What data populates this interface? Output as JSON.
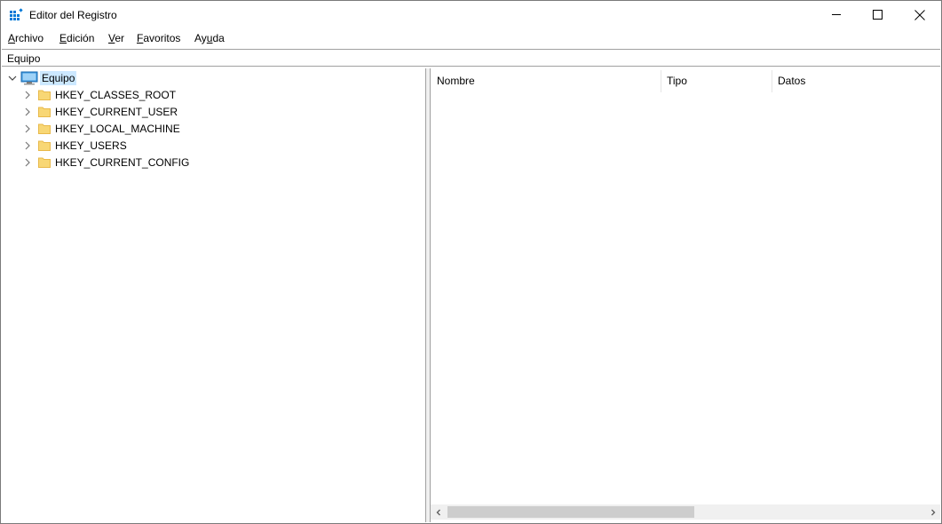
{
  "window": {
    "title": "Editor del Registro"
  },
  "menu": [
    {
      "label": "Archivo",
      "mnemonic": "A",
      "rest": "rchivo"
    },
    {
      "label": "Edición",
      "mnemonic": "E",
      "rest": "dición"
    },
    {
      "label": "Ver",
      "mnemonic": "V",
      "rest": "er"
    },
    {
      "label": "Favoritos",
      "mnemonic": "F",
      "rest": "avoritos"
    },
    {
      "label": "Ayuda",
      "pre": "Ay",
      "mnemonic": "u",
      "rest": "da"
    }
  ],
  "address": {
    "path": "Equipo"
  },
  "tree": {
    "root": {
      "label": "Equipo",
      "icon": "computer-icon",
      "expanded": true
    },
    "children": [
      {
        "label": "HKEY_CLASSES_ROOT",
        "icon": "folder-icon"
      },
      {
        "label": "HKEY_CURRENT_USER",
        "icon": "folder-icon"
      },
      {
        "label": "HKEY_LOCAL_MACHINE",
        "icon": "folder-icon"
      },
      {
        "label": "HKEY_USERS",
        "icon": "folder-icon"
      },
      {
        "label": "HKEY_CURRENT_CONFIG",
        "icon": "folder-icon"
      }
    ]
  },
  "list": {
    "columns": [
      "Nombre",
      "Tipo",
      "Datos"
    ]
  },
  "colors": {
    "selection": "#cce8ff",
    "folder": "#f8d775",
    "folder_dark": "#e8b94a",
    "app_icon": "#0078d7"
  }
}
